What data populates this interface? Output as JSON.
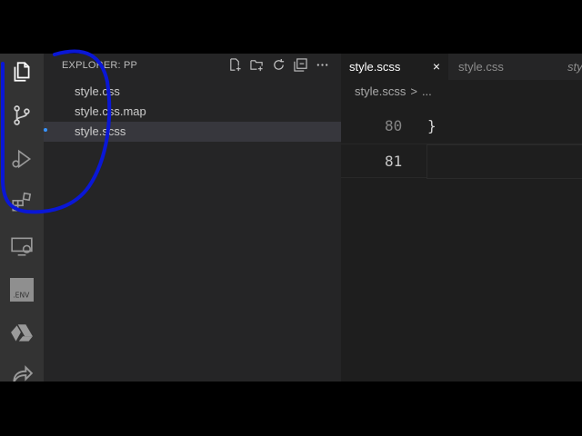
{
  "explorer": {
    "title": "EXPLORER: PP",
    "files": [
      "style.css",
      "style.css.map",
      "style.scss"
    ]
  },
  "tabs": [
    {
      "label": "style.scss",
      "close": "×"
    },
    {
      "label": "style.css"
    },
    {
      "label": "style"
    }
  ],
  "breadcrumb": {
    "file": "style.scss",
    "sep": ">",
    "more": "..."
  },
  "editor": {
    "lines": [
      {
        "num": "80",
        "code": "}"
      },
      {
        "num": "81",
        "code": ""
      }
    ]
  },
  "icons": {
    "activity": [
      "explorer-icon",
      "source-control-icon",
      "run-debug-icon",
      "extensions-icon",
      "remote-explorer-icon",
      "env-icon",
      "drive-icon",
      "share-icon"
    ],
    "env_label": ".ENV"
  },
  "colors": {
    "annotation": "#0a17d6",
    "activity_bar": "#333333",
    "sidebar": "#252526",
    "editor": "#1e1e1e",
    "modified_dot": "#3794ff"
  }
}
